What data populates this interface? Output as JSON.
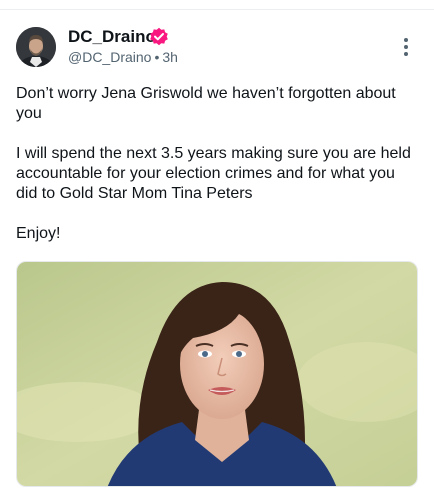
{
  "post": {
    "author": {
      "display_name": "DC_Draino",
      "handle": "@DC_Draino",
      "separator": "•",
      "timestamp": "3h",
      "verified": true,
      "badge_color": "#f91880"
    },
    "more_icon": "more-vertical-icon",
    "paragraphs": [
      "Don’t worry Jena Griswold we haven’t forgotten about you",
      "I will spend the next 3.5 years making sure you are held accountable for your election crimes and for what you did to Gold Star Mom Tina Peters",
      "Enjoy!"
    ],
    "media": {
      "type": "photo",
      "background_color": "#c8d29a"
    }
  }
}
